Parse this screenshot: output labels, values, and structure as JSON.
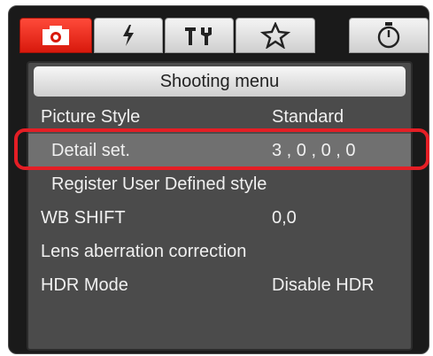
{
  "window": {
    "title": "Shooting menu"
  },
  "tabs": [
    {
      "icon": "camera-icon",
      "active": true
    },
    {
      "icon": "flash-icon",
      "active": false
    },
    {
      "icon": "tools-icon",
      "active": false
    },
    {
      "icon": "star-icon",
      "active": false
    },
    {
      "icon": "timer-icon",
      "active": false
    }
  ],
  "menu": {
    "items": [
      {
        "label": "Picture Style",
        "value": "Standard"
      },
      {
        "label": "Detail set.",
        "value": "3 , 0 , 0 , 0"
      },
      {
        "label": "Register User Defined style",
        "value": ""
      },
      {
        "label": "WB SHIFT",
        "value": "0,0"
      },
      {
        "label": "Lens aberration correction",
        "value": ""
      },
      {
        "label": "HDR Mode",
        "value": "Disable HDR"
      }
    ]
  },
  "colors": {
    "active_tab": "#d8190c",
    "highlight_outline": "#e41e25",
    "panel_bg": "#4b4b4b",
    "selected_row_bg": "#707070"
  }
}
